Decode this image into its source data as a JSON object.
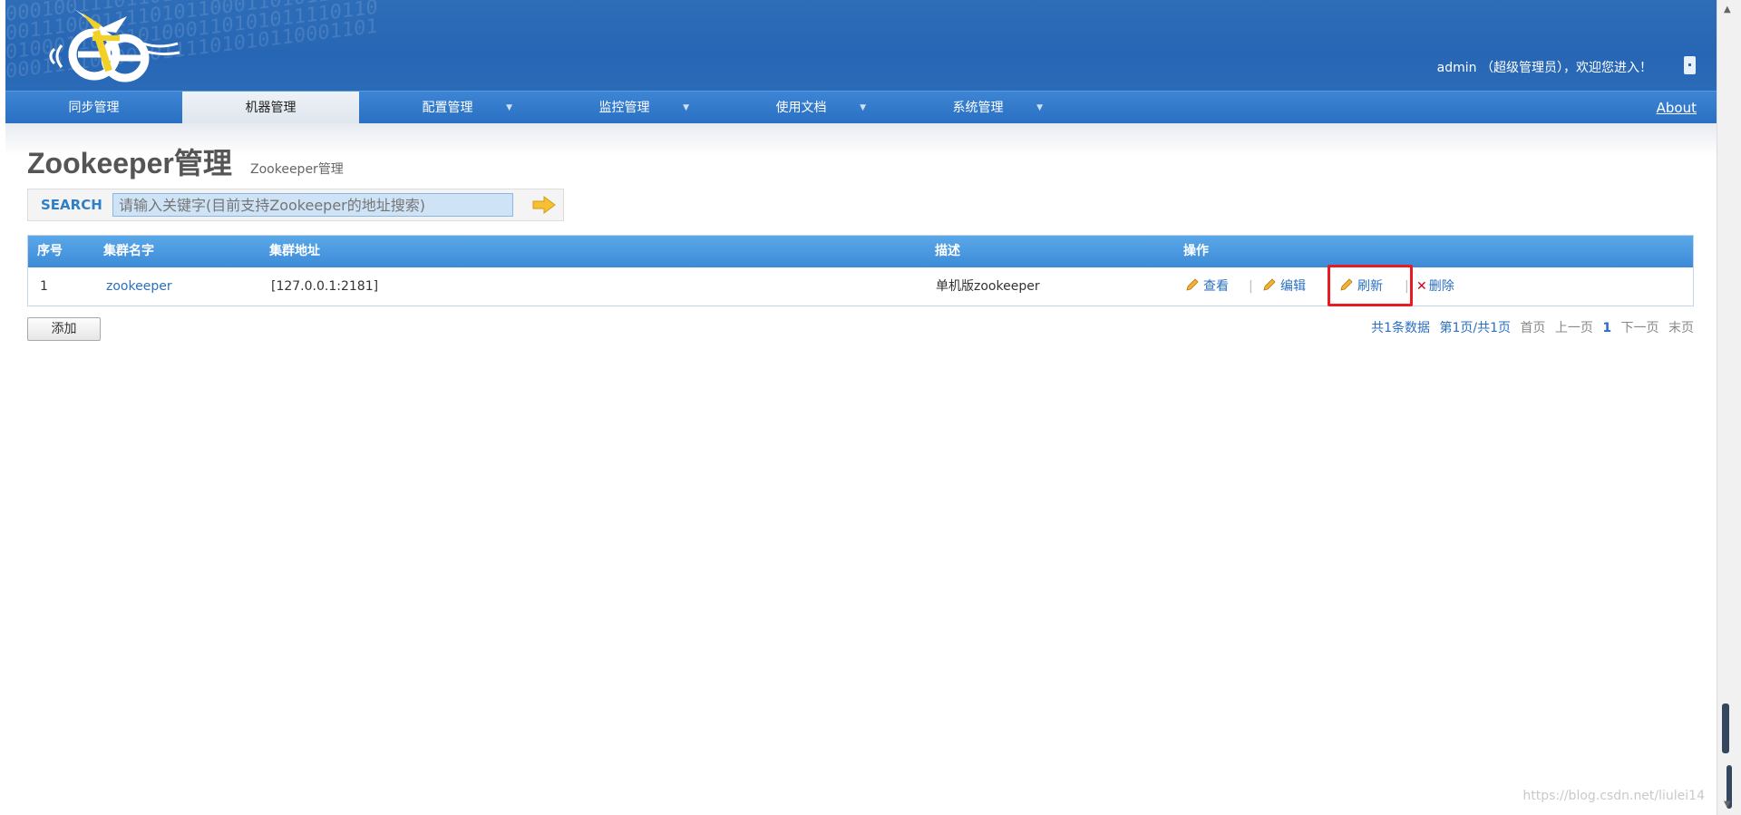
{
  "header": {
    "user_info": "admin （超级管理员），欢迎您进入！",
    "binary_pattern": "0001001110110101101000111010110\n0011100011110101100011010111100\n0100011010101000110101011110110\n0001111000010111101010110001101"
  },
  "nav": {
    "items": [
      {
        "label": "同步管理",
        "dropdown": false,
        "active": false
      },
      {
        "label": "机器管理",
        "dropdown": false,
        "active": true
      },
      {
        "label": "配置管理",
        "dropdown": true,
        "active": false
      },
      {
        "label": "监控管理",
        "dropdown": true,
        "active": false
      },
      {
        "label": "使用文档",
        "dropdown": true,
        "active": false
      },
      {
        "label": "系统管理",
        "dropdown": true,
        "active": false
      }
    ],
    "about": "About",
    "caret": "▼"
  },
  "page": {
    "title": "Zookeeper管理",
    "subtitle": "Zookeeper管理"
  },
  "search": {
    "label": "SEARCH",
    "placeholder": "请输入关键字(目前支持Zookeeper的地址搜索)"
  },
  "table": {
    "headers": [
      "序号",
      "集群名字",
      "集群地址",
      "描述",
      "操作"
    ],
    "rows": [
      {
        "index": "1",
        "name": "zookeeper",
        "address": "[127.0.0.1:2181]",
        "description": "单机版zookeeper",
        "actions": {
          "view": "查看",
          "edit": "编辑",
          "refresh": "刷新",
          "delete": "删除",
          "separator": "|"
        }
      }
    ]
  },
  "add_button": "添加",
  "pager": {
    "total": "共1条数据",
    "page_info": "第1页/共1页",
    "first": "首页",
    "prev": "上一页",
    "current": "1",
    "next": "下一页",
    "last": "末页"
  },
  "watermark": "https://blog.csdn.net/liulei14",
  "colors": {
    "header_blue": "#2766b4",
    "link_blue": "#2a6fc2",
    "highlight_red": "#e51c23"
  }
}
